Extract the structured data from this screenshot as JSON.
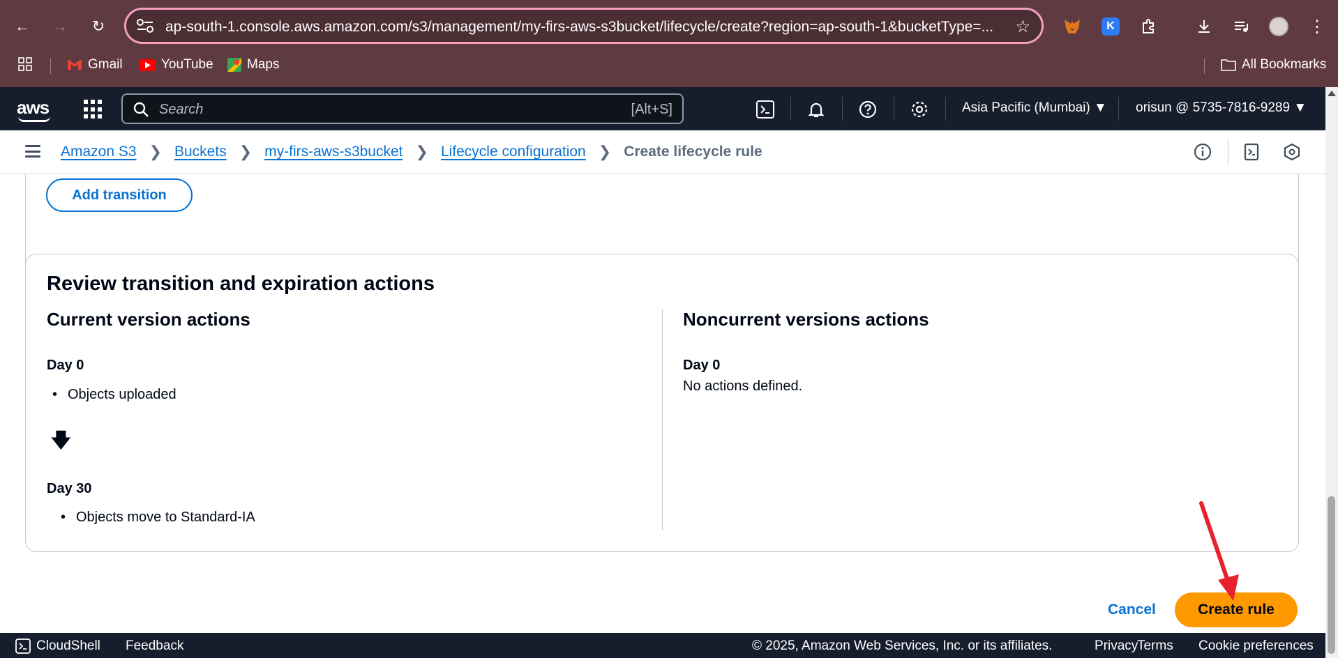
{
  "browser": {
    "url": "ap-south-1.console.aws.amazon.com/s3/management/my-firs-aws-s3bucket/lifecycle/create?region=ap-south-1&bucketType=...",
    "bookmarks": [
      "Gmail",
      "YouTube",
      "Maps"
    ],
    "all_bookmarks": "All Bookmarks"
  },
  "awsnav": {
    "search_placeholder": "Search",
    "search_shortcut": "[Alt+S]",
    "region": "Asia Pacific (Mumbai)",
    "account": "orisun @ 5735-7816-9289"
  },
  "breadcrumb": {
    "items": [
      "Amazon S3",
      "Buckets",
      "my-firs-aws-s3bucket",
      "Lifecycle configuration"
    ],
    "current": "Create lifecycle rule"
  },
  "main": {
    "add_transition": "Add transition",
    "review": {
      "title": "Review transition and expiration actions",
      "current": {
        "title": "Current version actions",
        "day0": "Day 0",
        "day0_item": "Objects uploaded",
        "day30": "Day 30",
        "day30_item": "Objects move to Standard-IA"
      },
      "noncurrent": {
        "title": "Noncurrent versions actions",
        "day0": "Day 0",
        "day0_text": "No actions defined."
      }
    },
    "cancel": "Cancel",
    "create": "Create rule"
  },
  "footer": {
    "cloudshell": "CloudShell",
    "feedback": "Feedback",
    "copyright": "© 2025, Amazon Web Services, Inc. or its affiliates.",
    "privacy": "Privacy",
    "terms": "Terms",
    "cookies": "Cookie preferences"
  },
  "colors": {
    "link": "#0972d3",
    "primary_button": "#ff9900",
    "nav_bg": "#161e2d",
    "chrome_bg": "#5f3a40",
    "annotation_arrow": "#e8212e"
  }
}
